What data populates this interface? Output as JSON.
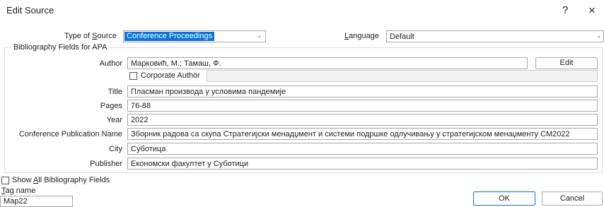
{
  "window": {
    "title": "Edit Source",
    "help_label": "?",
    "close_label": "×"
  },
  "source_type": {
    "label_pre": "Type of ",
    "label_u": "S",
    "label_post": "ource",
    "value": "Conference Proceedings"
  },
  "language": {
    "label_u": "L",
    "label_post": "anguage",
    "value": "Default"
  },
  "group_title": "Bibliography Fields for APA",
  "fields": {
    "author": {
      "label": "Author",
      "value": "Марковић, М.; Тамаш, Ф."
    },
    "corporate_author_label": "Corporate Author",
    "title": {
      "label": "Title",
      "value": "Пласман производа у условима пандемије"
    },
    "pages": {
      "label": "Pages",
      "value": "76-88"
    },
    "year": {
      "label": "Year",
      "value": "2022"
    },
    "conference": {
      "label": "Conference Publication Name",
      "value": "Зборник радова са скупа Стратегијски менадџмент и системи подршке одлучивању у стратегијском менаџменту СМ2022"
    },
    "city": {
      "label": "City",
      "value": "Суботица"
    },
    "publisher": {
      "label": "Publisher",
      "value": "Економски факултет у Суботици"
    }
  },
  "buttons": {
    "edit": "Edit",
    "ok": "OK",
    "cancel": "Cancel"
  },
  "show_all": {
    "label_pre": "Show ",
    "label_u": "A",
    "label_post": "ll Bibliography Fields"
  },
  "tag": {
    "label_u": "T",
    "label_post": "ag name",
    "value": "Map22"
  },
  "colors": {
    "accent": "#0a74d9",
    "border": "#a9a9a9"
  }
}
